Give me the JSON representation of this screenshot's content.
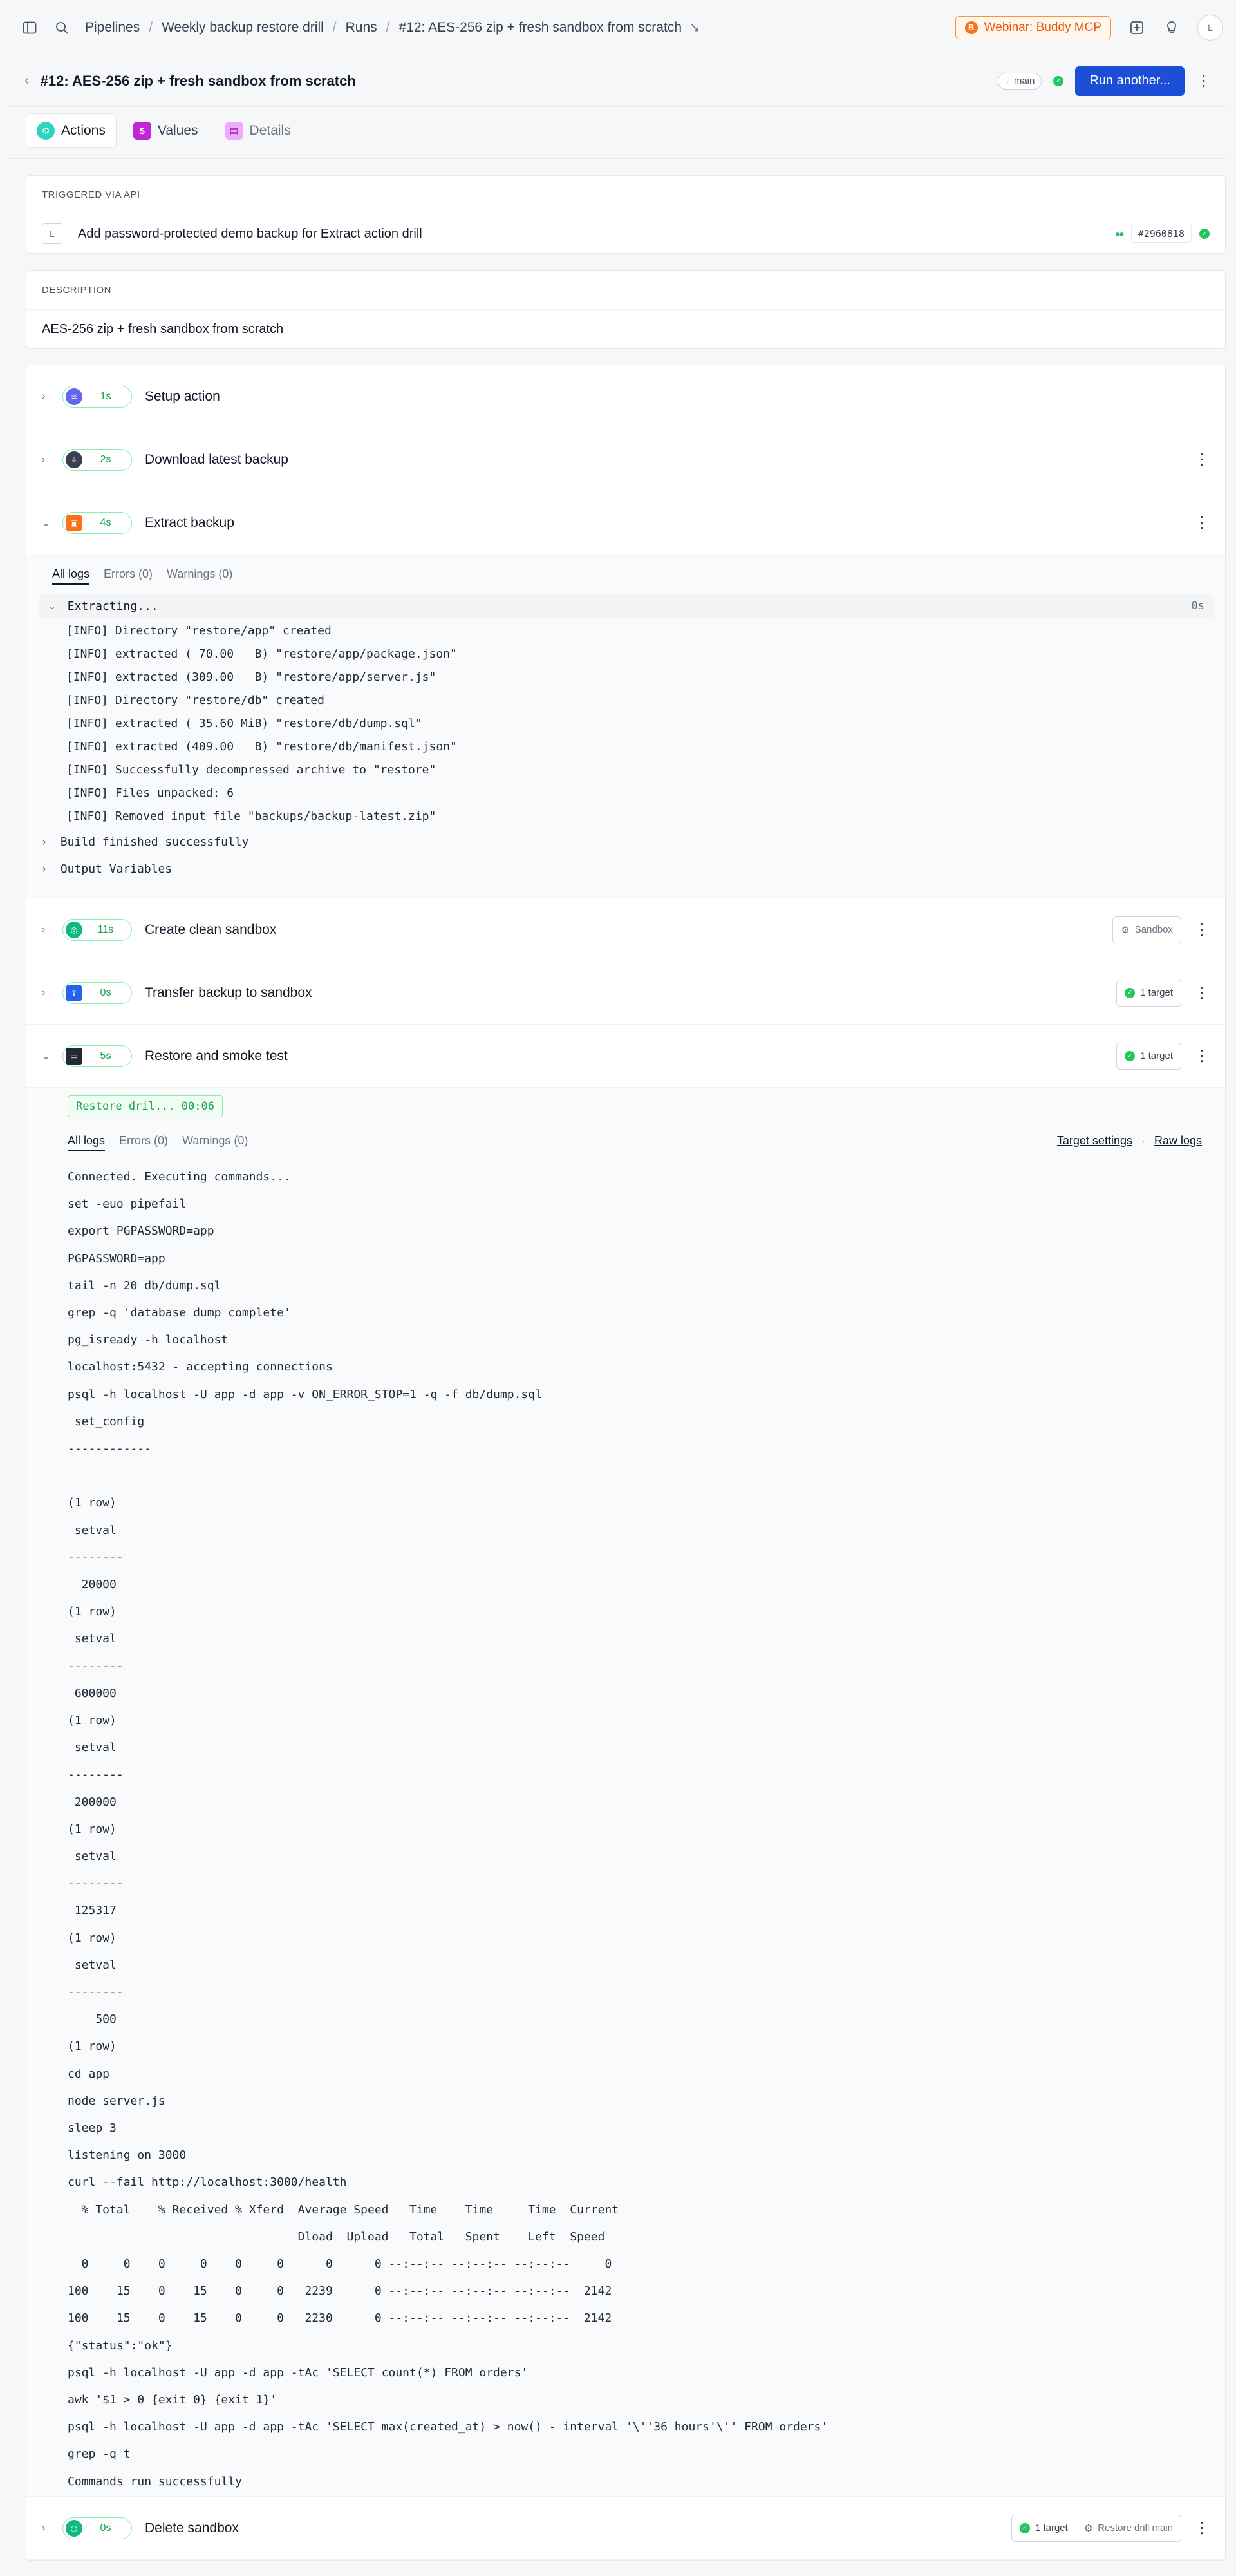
{
  "topbar": {
    "crumbs": [
      "Pipelines",
      "Weekly backup restore drill",
      "Runs",
      "#12: AES-256 zip + fresh sandbox from scratch"
    ],
    "webinar": "Webinar: Buddy MCP",
    "avatar": "L"
  },
  "title": {
    "text": "#12: AES-256 zip + fresh sandbox from scratch",
    "branch": "main",
    "run_button": "Run another..."
  },
  "tabs": [
    {
      "label": "Actions"
    },
    {
      "label": "Values"
    },
    {
      "label": "Details"
    }
  ],
  "trigger": {
    "heading": "TRIGGERED VIA API",
    "avatar": "L",
    "message": "Add password-protected demo backup for Extract action drill",
    "hash": "#2960818"
  },
  "description": {
    "heading": "DESCRIPTION",
    "text": "AES-256 zip + fresh sandbox from scratch"
  },
  "actions": [
    {
      "name": "Setup action",
      "time": "1s"
    },
    {
      "name": "Download latest backup",
      "time": "2s"
    },
    {
      "name": "Extract backup",
      "time": "4s"
    },
    {
      "name": "Create clean sandbox",
      "time": "11s",
      "tag": "Sandbox"
    },
    {
      "name": "Transfer backup to sandbox",
      "time": "0s",
      "tag": "1 target"
    },
    {
      "name": "Restore and smoke test",
      "time": "5s",
      "tag": "1 target"
    },
    {
      "name": "Delete sandbox",
      "time": "0s",
      "tag": "1 target",
      "tag2": "Restore drill main"
    }
  ],
  "log_tabs": {
    "all": "All logs",
    "errors": "Errors (0)",
    "warnings": "Warnings (0)"
  },
  "extract_log": {
    "section": "Extracting...",
    "duration": "0s",
    "lines": [
      "[INFO] Directory \"restore/app\" created",
      "[INFO] extracted ( 70.00   B) \"restore/app/package.json\"",
      "[INFO] extracted (309.00   B) \"restore/app/server.js\"",
      "[INFO] Directory \"restore/db\" created",
      "[INFO] extracted ( 35.60 MiB) \"restore/db/dump.sql\"",
      "[INFO] extracted (409.00   B) \"restore/db/manifest.json\"",
      "[INFO] Successfully decompressed archive to \"restore\"",
      "[INFO] Files unpacked: 6",
      "[INFO] Removed input file \"backups/backup-latest.zip\""
    ],
    "footer": [
      "Build finished successfully",
      "Output Variables"
    ]
  },
  "restore_log": {
    "badge": "Restore dril... 00:06",
    "links": [
      "Target settings",
      "·",
      "Raw logs"
    ],
    "lines": [
      "Connected. Executing commands...",
      "set -euo pipefail",
      "export PGPASSWORD=app",
      "PGPASSWORD=app",
      "tail -n 20 db/dump.sql",
      "grep -q 'database dump complete'",
      "pg_isready -h localhost",
      "localhost:5432 - accepting connections",
      "psql -h localhost -U app -d app -v ON_ERROR_STOP=1 -q -f db/dump.sql",
      " set_config",
      "------------",
      "",
      "(1 row)",
      " setval",
      "--------",
      "  20000",
      "(1 row)",
      " setval",
      "--------",
      " 600000",
      "(1 row)",
      " setval",
      "--------",
      " 200000",
      "(1 row)",
      " setval",
      "--------",
      " 125317",
      "(1 row)",
      " setval",
      "--------",
      "    500",
      "(1 row)",
      "cd app",
      "node server.js",
      "sleep 3",
      "listening on 3000",
      "curl --fail http://localhost:3000/health",
      "  % Total    % Received % Xferd  Average Speed   Time    Time     Time  Current",
      "                                 Dload  Upload   Total   Spent    Left  Speed",
      "  0     0    0     0    0     0      0      0 --:--:-- --:--:-- --:--:--     0",
      "100    15    0    15    0     0   2239      0 --:--:-- --:--:-- --:--:--  2142",
      "100    15    0    15    0     0   2230      0 --:--:-- --:--:-- --:--:--  2142",
      "{\"status\":\"ok\"}",
      "psql -h localhost -U app -d app -tAc 'SELECT count(*) FROM orders'",
      "awk '$1 > 0 {exit 0} {exit 1}'",
      "psql -h localhost -U app -d app -tAc 'SELECT max(created_at) > now() - interval '\\''36 hours'\\'' FROM orders'",
      "grep -q t",
      "Commands run successfully"
    ]
  },
  "colors": {
    "primary": "#1d4ed8",
    "success": "#22c55e",
    "webinar": "#ea580c"
  }
}
